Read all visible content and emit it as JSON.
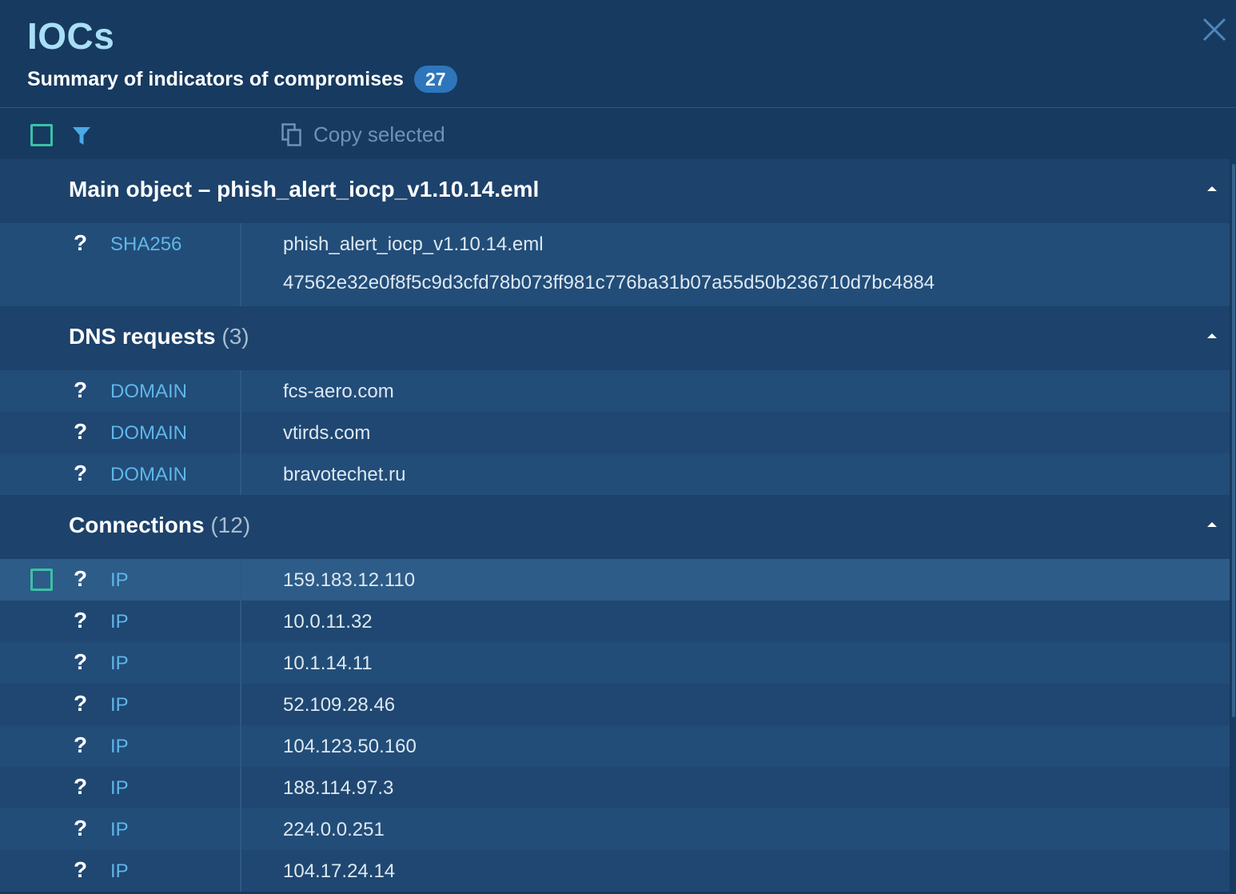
{
  "header": {
    "title": "IOCs",
    "subtitle": "Summary of indicators of compromises",
    "count": "27"
  },
  "toolbar": {
    "copy_label": "Copy selected"
  },
  "sections": {
    "main": {
      "title": "Main object  –  phish_alert_iocp_v1.10.14.eml",
      "rows": [
        {
          "type": "SHA256",
          "value": "phish_alert_iocp_v1.10.14.eml",
          "value2": "47562e32e0f8f5c9d3cfd78b073ff981c776ba31b07a55d50b236710d7bc4884"
        }
      ]
    },
    "dns": {
      "title": "DNS requests",
      "count": "(3)",
      "rows": [
        {
          "type": "DOMAIN",
          "value": "fcs-aero.com"
        },
        {
          "type": "DOMAIN",
          "value": "vtirds.com"
        },
        {
          "type": "DOMAIN",
          "value": "bravotechet.ru"
        }
      ]
    },
    "connections": {
      "title": "Connections",
      "count": "(12)",
      "rows": [
        {
          "type": "IP",
          "value": "159.183.12.110"
        },
        {
          "type": "IP",
          "value": "10.0.11.32"
        },
        {
          "type": "IP",
          "value": "10.1.14.11"
        },
        {
          "type": "IP",
          "value": "52.109.28.46"
        },
        {
          "type": "IP",
          "value": "104.123.50.160"
        },
        {
          "type": "IP",
          "value": "188.114.97.3"
        },
        {
          "type": "IP",
          "value": "224.0.0.251"
        },
        {
          "type": "IP",
          "value": "104.17.24.14"
        }
      ]
    }
  },
  "unknown_marker": "?",
  "icons": {
    "close": "close-icon",
    "filter": "filter-icon",
    "copy": "copy-icon",
    "collapse": "chevron-up-icon"
  },
  "colors": {
    "background": "#173a60",
    "title": "#a9dff6",
    "badge": "#2d76bc",
    "checkbox": "#3cc0a6",
    "type_label": "#5fb6ea"
  }
}
